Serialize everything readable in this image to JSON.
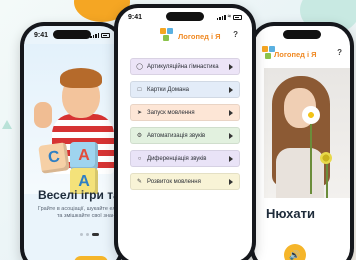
{
  "colors": {
    "accent_orange": "#f5b52a",
    "logo_orange": "#f08a24",
    "title_dark": "#1f2c3b"
  },
  "left_screen": {
    "status_time": "9:41",
    "title": "Веселі ігри та впр",
    "description": "Грайте в асоціації, шукайте елементи та змішкайте свої знан",
    "cube_letters": [
      "C",
      "A",
      "A"
    ],
    "page_dots": 3,
    "active_dot": 2
  },
  "main_screen": {
    "status_time": "9:41",
    "logo_text": "Логопед і Я",
    "help_label": "?",
    "menu_items": [
      {
        "label": "Артикуляційна гімнастика",
        "icon": "mouth-icon",
        "color": "#ece4f7"
      },
      {
        "label": "Картки Домана",
        "icon": "card-icon",
        "color": "#e3ecf8"
      },
      {
        "label": "Запуск мовлення",
        "icon": "rocket-icon",
        "color": "#fde6d6"
      },
      {
        "label": "Автоматизація звуків",
        "icon": "settings-icon",
        "color": "#e2f1df"
      },
      {
        "label": "Диференціація звуків",
        "icon": "ear-icon",
        "color": "#e9e3f7"
      },
      {
        "label": "Розвиток мовлення",
        "icon": "chat-icon",
        "color": "#f8f3d6"
      }
    ]
  },
  "right_screen": {
    "logo_text": "Логопед і Я",
    "help_label": "?",
    "word": "Нюхати",
    "sound_icon": "speaker-icon"
  }
}
